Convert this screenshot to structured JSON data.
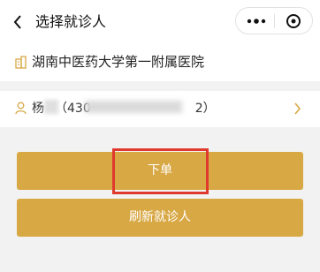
{
  "nav": {
    "title": "选择就诊人",
    "back_icon": "chevron-left-icon",
    "more_icon": "more-dots-icon",
    "close_icon": "target-circle-icon"
  },
  "hospital": {
    "icon": "hospital-building-icon",
    "name": "湖南中医药大学第一附属医院"
  },
  "patient": {
    "icon": "user-icon",
    "surname": "杨",
    "id_prefix": "（430",
    "id_suffix": "2）",
    "chevron_icon": "chevron-right-icon"
  },
  "actions": {
    "order_label": "下单",
    "refresh_label": "刷新就诊人"
  },
  "colors": {
    "accent": "#d8a845",
    "highlight": "#e03a2f",
    "background": "#f2f2f2"
  }
}
